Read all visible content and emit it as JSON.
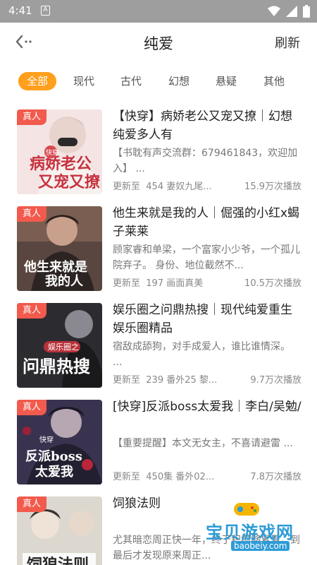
{
  "status_bar": {
    "time": "4:41",
    "notification_letter": "A"
  },
  "header": {
    "title": "纯爱",
    "refresh_label": "刷新"
  },
  "tabs": [
    {
      "label": "全部",
      "active": true
    },
    {
      "label": "现代",
      "active": false
    },
    {
      "label": "古代",
      "active": false
    },
    {
      "label": "幻想",
      "active": false
    },
    {
      "label": "悬疑",
      "active": false
    },
    {
      "label": "其他",
      "active": false
    }
  ],
  "items": [
    {
      "badge": "真人",
      "title": "【快穿】病娇老公又宠又撩｜幻想纯爱多人有",
      "desc": "【书耽有声交流群：679461843，欢迎加入】 ...",
      "update_prefix": "更新至",
      "update": "454 妻奴九尾...",
      "plays": "15.9万次播放",
      "cover_text": "病娇老公又宠又撩",
      "cover_tag": "快穿",
      "cover_bg": "#f3e6e6"
    },
    {
      "badge": "真人",
      "title": "他生来就是我的人｜倔强的小红x蝎子莱莱",
      "desc": "顾家睿和单梁，一个富家小少爷，一个孤儿院弃子。 身份、地位截然不...",
      "update_prefix": "更新至",
      "update": "197 画面真美",
      "plays": "10.5万次播放",
      "cover_text": "他生来就是我的人",
      "cover_tag": "",
      "cover_bg": "#4a3a36"
    },
    {
      "badge": "真人",
      "title": "娱乐圈之问鼎热搜｜现代纯爱重生娱乐圈精品",
      "desc": "宿敌成舔狗，对手成爱人，谁比谁情深。 ...",
      "update_prefix": "更新至",
      "update": "239 番外25 黎...",
      "plays": "9.7万次播放",
      "cover_text": "问鼎热搜",
      "cover_tag": "娱乐圈之",
      "cover_bg": "#2a2a2e"
    },
    {
      "badge": "真人",
      "title": "[快穿]反派boss太爱我｜李白/吴勉/",
      "desc": "【重要提醒】本文无女主，不喜请避雷 ...",
      "update_prefix": "更新至",
      "update": "450集 番外02...",
      "plays": "7.8万次播放",
      "cover_text": "反派boss太爱我",
      "cover_tag": "快穿",
      "cover_bg": "#3b3350"
    },
    {
      "badge": "真人",
      "title": "饲狼法则",
      "desc": "尤其暗恋周正快一年，终于积攒够累累，到最后才发现原来周正...",
      "update_prefix": "",
      "update": "",
      "plays": "",
      "cover_text": "饲狼法则",
      "cover_tag": "",
      "cover_bg": "#d9d4cc"
    }
  ],
  "watermark": {
    "name": "宝贝游戏网",
    "url": "baobeiy.com"
  }
}
